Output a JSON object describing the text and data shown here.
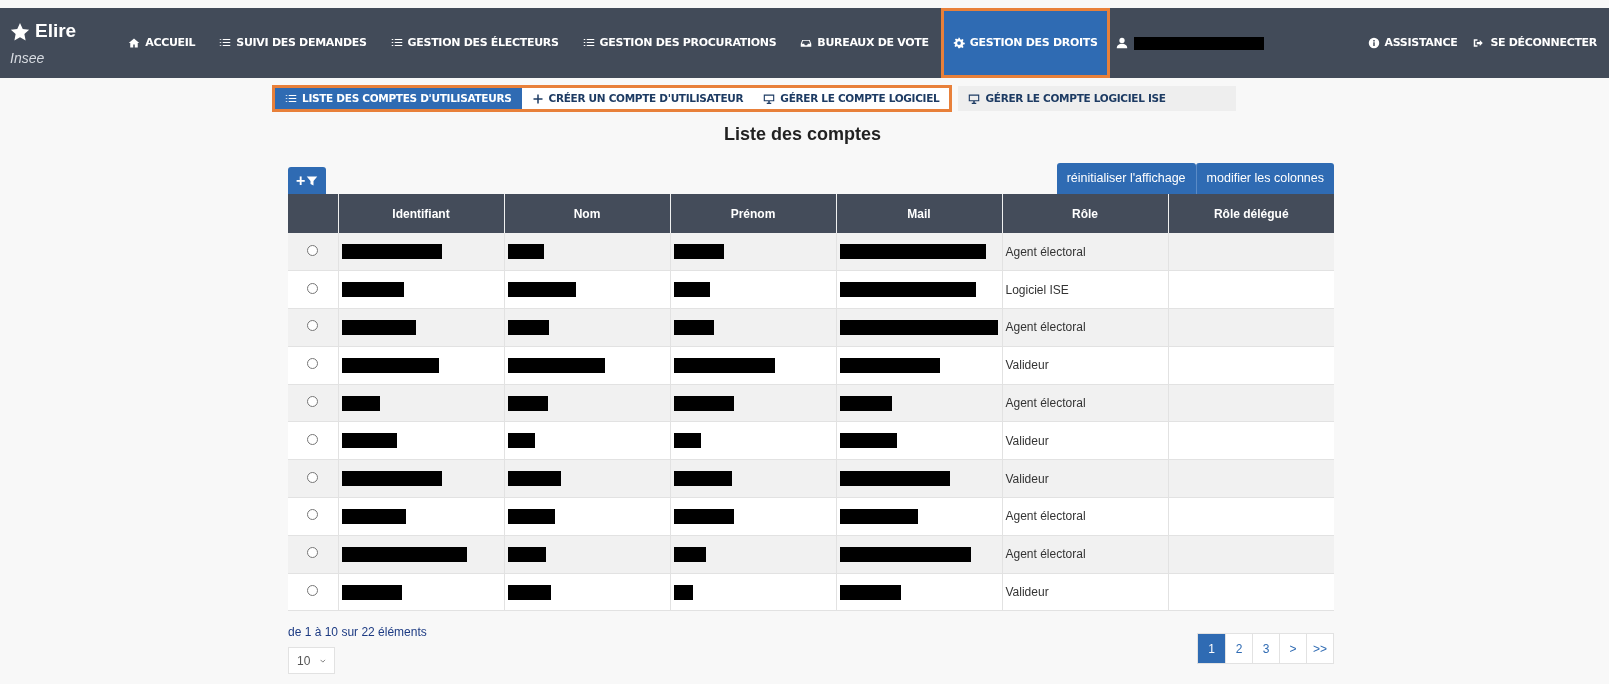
{
  "brand": {
    "name": "Elire",
    "subtitle": "Insee"
  },
  "nav": [
    {
      "label": "ACCUEIL",
      "kind": "home",
      "selected": false,
      "highlighted": false
    },
    {
      "label": "SUIVI DES DEMANDES",
      "kind": "checklist",
      "selected": false,
      "highlighted": false
    },
    {
      "label": "GESTION DES ÉLECTEURS",
      "kind": "list",
      "selected": false,
      "highlighted": false
    },
    {
      "label": "GESTION DES PROCURATIONS",
      "kind": "list",
      "selected": false,
      "highlighted": false
    },
    {
      "label": "BUREAUX DE VOTE",
      "kind": "inbox",
      "selected": false,
      "highlighted": false
    },
    {
      "label": "GESTION DES DROITS",
      "kind": "gear",
      "selected": true,
      "highlighted": true
    }
  ],
  "user": {
    "redacted": true
  },
  "nav_right": [
    {
      "label": "ASSISTANCE",
      "kind": "info"
    },
    {
      "label": "SE DÉCONNECTER",
      "kind": "logout"
    }
  ],
  "subtabs": [
    {
      "label": "LISTE DES COMPTES D'UTILISATEURS",
      "kind": "checklist",
      "selected": true,
      "highlighted": true
    },
    {
      "label": "CRÉER UN COMPTE D'UTILISATEUR",
      "kind": "plus",
      "selected": false,
      "highlighted": true
    },
    {
      "label": "GÉRER LE COMPTE LOGICIEL",
      "kind": "monitor",
      "selected": false,
      "highlighted": true
    },
    {
      "label": "GÉRER LE COMPTE LOGICIEL ISE",
      "kind": "monitor",
      "selected": false,
      "highlighted": false
    }
  ],
  "page_title": "Liste des comptes",
  "toolbar": {
    "filter_button": "+",
    "buttons": [
      "réinitialiser l'affichage",
      "modifier les colonnes"
    ]
  },
  "table": {
    "columns": [
      "Identifiant",
      "Nom",
      "Prénom",
      "Mail",
      "Rôle",
      "Rôle délégué"
    ],
    "rows": [
      {
        "selected": false,
        "cells": [
          {
            "redacted": true
          },
          {
            "redacted": true
          },
          {
            "redacted": true
          },
          {
            "redacted": true
          },
          {
            "text": "Agent électoral"
          }
        ]
      },
      {
        "selected": false,
        "cells": [
          {
            "redacted": true
          },
          {
            "redacted": true
          },
          {
            "redacted": true
          },
          {
            "redacted": true
          },
          {
            "text": "Logiciel ISE"
          }
        ]
      },
      {
        "selected": false,
        "cells": [
          {
            "redacted": true
          },
          {
            "redacted": true
          },
          {
            "redacted": true
          },
          {
            "redacted": true
          },
          {
            "text": "Agent électoral"
          }
        ]
      },
      {
        "selected": false,
        "cells": [
          {
            "redacted": true
          },
          {
            "redacted": true
          },
          {
            "redacted": true
          },
          {
            "redacted": true
          },
          {
            "text": "Valideur"
          }
        ]
      },
      {
        "selected": false,
        "cells": [
          {
            "redacted": true
          },
          {
            "redacted": true
          },
          {
            "redacted": true
          },
          {
            "redacted": true
          },
          {
            "text": "Agent électoral"
          }
        ]
      },
      {
        "selected": false,
        "cells": [
          {
            "redacted": true
          },
          {
            "redacted": true
          },
          {
            "redacted": true
          },
          {
            "redacted": true
          },
          {
            "text": "Valideur"
          }
        ]
      },
      {
        "selected": false,
        "cells": [
          {
            "redacted": true
          },
          {
            "redacted": true
          },
          {
            "redacted": true
          },
          {
            "redacted": true
          },
          {
            "text": "Valideur"
          }
        ]
      },
      {
        "selected": false,
        "cells": [
          {
            "redacted": true
          },
          {
            "redacted": true
          },
          {
            "redacted": true
          },
          {
            "redacted": true
          },
          {
            "text": "Agent électoral"
          }
        ]
      },
      {
        "selected": false,
        "cells": [
          {
            "redacted": true
          },
          {
            "redacted": true
          },
          {
            "redacted": true
          },
          {
            "redacted": true
          },
          {
            "text": "Agent électoral"
          }
        ]
      },
      {
        "selected": false,
        "cells": [
          {
            "redacted": true
          },
          {
            "redacted": true
          },
          {
            "redacted": true
          },
          {
            "redacted": true
          },
          {
            "text": "Valideur"
          }
        ]
      }
    ]
  },
  "summary": "de 1 à 10 sur 22 éléments",
  "page_size": "10",
  "pagination": [
    {
      "label": "1",
      "selected": true
    },
    {
      "label": "2",
      "selected": false
    },
    {
      "label": "3",
      "selected": false
    },
    {
      "label": ">",
      "selected": false
    },
    {
      "label": ">>",
      "selected": false
    }
  ]
}
